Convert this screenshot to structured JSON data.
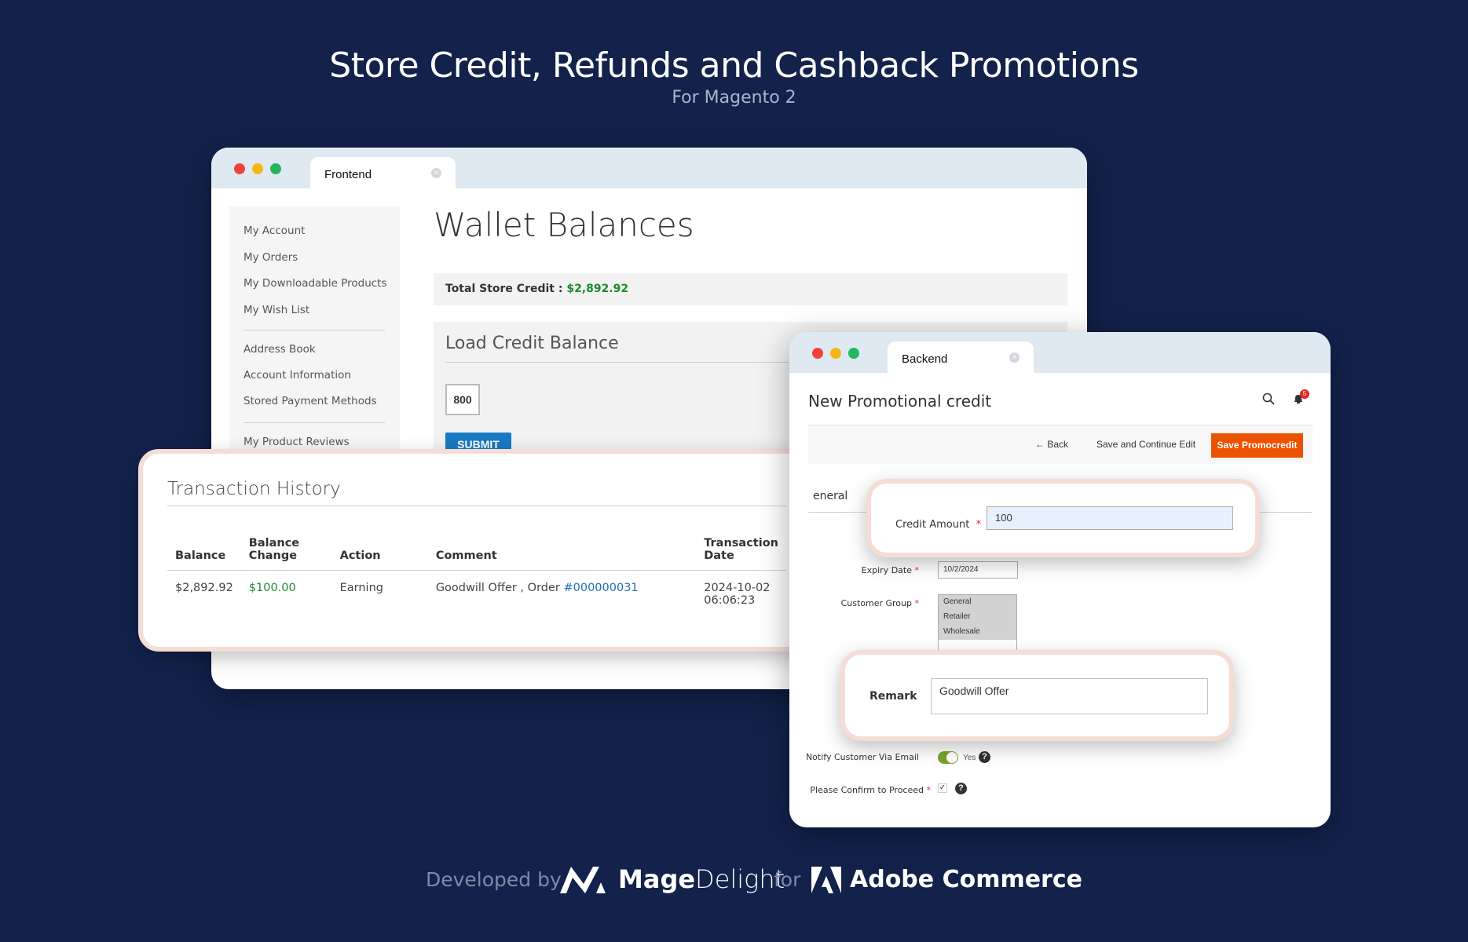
{
  "header": {
    "title": "Store Credit, Refunds and Cashback Promotions",
    "subtitle": "For Magento 2"
  },
  "frontend": {
    "tab": "Frontend",
    "sidebar": [
      "My Account",
      "My Orders",
      "My Downloadable Products",
      "My Wish List",
      "Address Book",
      "Account Information",
      "Stored Payment Methods",
      "My Product Reviews"
    ],
    "page_title": "Wallet Balances",
    "total_label": "Total Store Credit :",
    "total_value": "$2,892.92",
    "load_title": "Load Credit Balance",
    "load_value": "800",
    "submit": "SUBMIT"
  },
  "transactions": {
    "title": "Transaction History",
    "headers": [
      "Balance",
      "Balance Change",
      "Action",
      "Comment",
      "Transaction Date"
    ],
    "rows": [
      {
        "balance": "$2,892.92",
        "change": "$100.00",
        "action": "Earning",
        "comment": "Goodwill Offer , Order ",
        "order": "#000000031",
        "date": "2024-10-02",
        "time": "06:06:23"
      }
    ]
  },
  "backend": {
    "tab": "Backend",
    "title": "New Promotional credit",
    "notifications": "5",
    "back": "Back",
    "save_continue": "Save and Continue Edit",
    "save": "Save Promocredit",
    "section": "eneral",
    "credit_label": "Credit Amount",
    "credit_value": "100",
    "expiry_label": "Expiry Date",
    "expiry_value": "10/2/2024",
    "group_label": "Customer Group",
    "groups": [
      "General",
      "Retailer",
      "Wholesale"
    ],
    "remark_label": "Remark",
    "remark_value": "Goodwill Offer",
    "notify_label": "Notify Customer Via Email",
    "notify_value": "Yes",
    "notify_on": true,
    "confirm_label": "Please Confirm to Proceed",
    "confirm_checked": true
  },
  "footer": {
    "developed": "Developed by",
    "brand_bold": "Mage",
    "brand_light": "Delight",
    "for": "for",
    "adobe": "Adobe Commerce"
  },
  "colors": {
    "background": "#12224b",
    "accent": "#eb5202",
    "green": "#1e8a2e",
    "link": "#1f6fb5"
  }
}
